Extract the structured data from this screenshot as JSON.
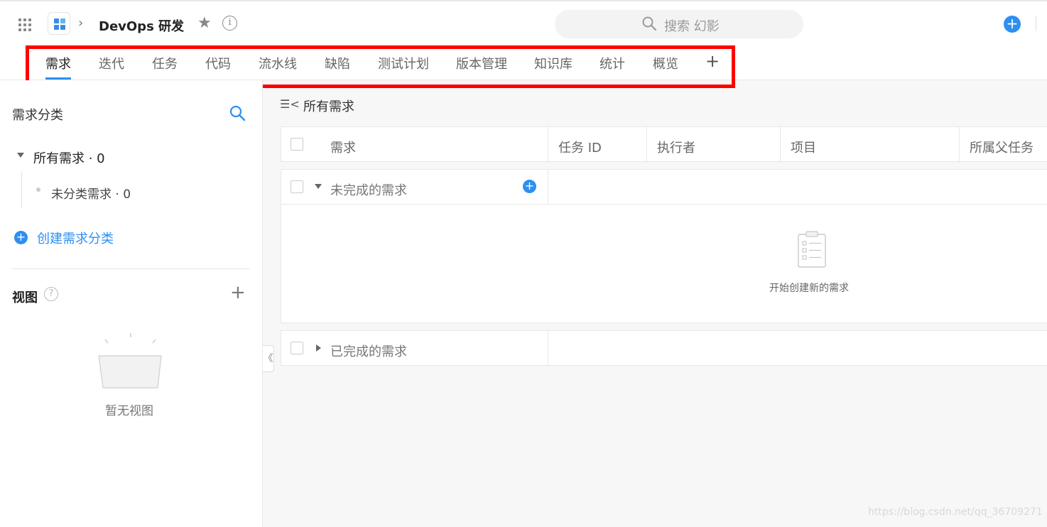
{
  "header": {
    "project_title": "DevOps 研发",
    "search_placeholder": "搜索 幻影",
    "icons": [
      "apps-grid-icon",
      "project-logo-icon",
      "chevron-right-icon",
      "caret-down-icon",
      "star-icon",
      "info-icon",
      "search-icon",
      "add-circle-icon"
    ],
    "info_glyph": "i",
    "add_glyph": "+"
  },
  "tabs": {
    "items": [
      "需求",
      "迭代",
      "任务",
      "代码",
      "流水线",
      "缺陷",
      "测试计划",
      "版本管理",
      "知识库",
      "统计",
      "概览"
    ],
    "active": "需求",
    "add_glyph": "+"
  },
  "sidebar": {
    "title": "需求分类",
    "all_requirements": "所有需求 · 0",
    "uncategorized": "未分类需求 · 0",
    "create_category": "创建需求分类",
    "views_label": "视图",
    "help_glyph": "?",
    "view_add_glyph": "+",
    "create_glyph": "+",
    "empty_views": "暂无视图",
    "collapse_glyph": "《"
  },
  "main": {
    "list_icon_glyph": "☰<",
    "title": "所有需求",
    "columns": [
      "需求",
      "任务 ID",
      "执行者",
      "项目",
      "所属父任务"
    ],
    "groups": [
      {
        "label": "未完成的需求",
        "expanded": true,
        "empty_hint": "开始创建新的需求"
      },
      {
        "label": "已完成的需求",
        "expanded": false
      }
    ],
    "group_add_glyph": "+"
  },
  "watermark": "https://blog.csdn.net/qq_36709271",
  "colors": {
    "accent": "#2e8ff0",
    "highlight": "#ff0000",
    "background": "#f7f7f7"
  }
}
